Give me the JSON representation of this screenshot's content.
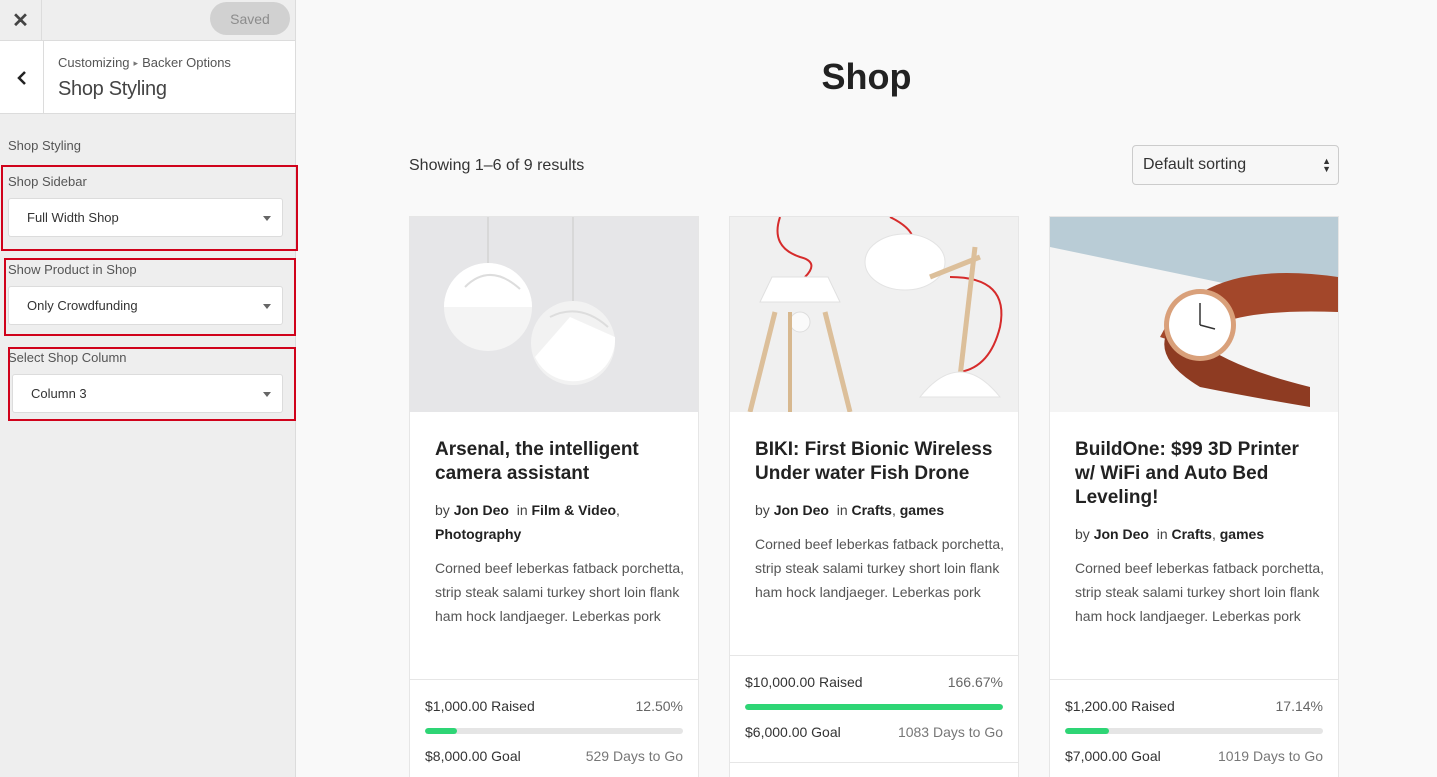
{
  "customizer": {
    "close_icon": "close-icon",
    "saved_label": "Saved",
    "back_icon": "chevron-left-icon",
    "breadcrumb_root": "Customizing",
    "breadcrumb_separator": "▸",
    "breadcrumb_parent": "Backer Options",
    "section_title": "Shop Styling",
    "group_title": "Shop Styling",
    "controls": [
      {
        "label": "Shop Sidebar",
        "value": "Full Width Shop"
      },
      {
        "label": "Show Product in Shop",
        "value": "Only Crowdfunding"
      },
      {
        "label": "Select Shop Column",
        "value": "Column 3"
      }
    ]
  },
  "shop": {
    "title": "Shop",
    "results": "Showing 1–6 of 9 results",
    "sorting": "Default sorting",
    "products": [
      {
        "title": "Arsenal, the intelligent camera assistant",
        "by": "by",
        "author": "Jon Deo",
        "in": "in",
        "cat1": "Film & Video",
        "cat2": "Photography",
        "description": "Corned beef leberkas fatback porchetta, strip steak salami turkey short loin flank ham hock landjaeger. Leberkas pork",
        "raised": "$1,000.00 Raised",
        "percent": "12.50%",
        "progress": 0.125,
        "goal": "$8,000.00 Goal",
        "days": "529 Days to Go"
      },
      {
        "title": "BIKI: First Bionic Wireless Under water Fish Drone",
        "by": "by",
        "author": "Jon Deo",
        "in": "in",
        "cat1": "Crafts",
        "cat2": "games",
        "description": "Corned beef leberkas fatback porchetta, strip steak salami turkey short loin flank ham hock landjaeger. Leberkas pork",
        "raised": "$10,000.00 Raised",
        "percent": "166.67%",
        "progress": 1.0,
        "goal": "$6,000.00 Goal",
        "days": "1083 Days to Go"
      },
      {
        "title": "BuildOne: $99 3D Printer w/ WiFi and Auto Bed Leveling!",
        "by": "by",
        "author": "Jon Deo",
        "in": "in",
        "cat1": "Crafts",
        "cat2": "games",
        "description": "Corned beef leberkas fatback porchetta, strip steak salami turkey short loin flank ham hock landjaeger. Leberkas pork",
        "raised": "$1,200.00 Raised",
        "percent": "17.14%",
        "progress": 0.1714,
        "goal": "$7,000.00 Goal",
        "days": "1019 Days to Go"
      }
    ]
  },
  "colors": {
    "progress": "#2ed575",
    "highlight": "#d0021b"
  }
}
